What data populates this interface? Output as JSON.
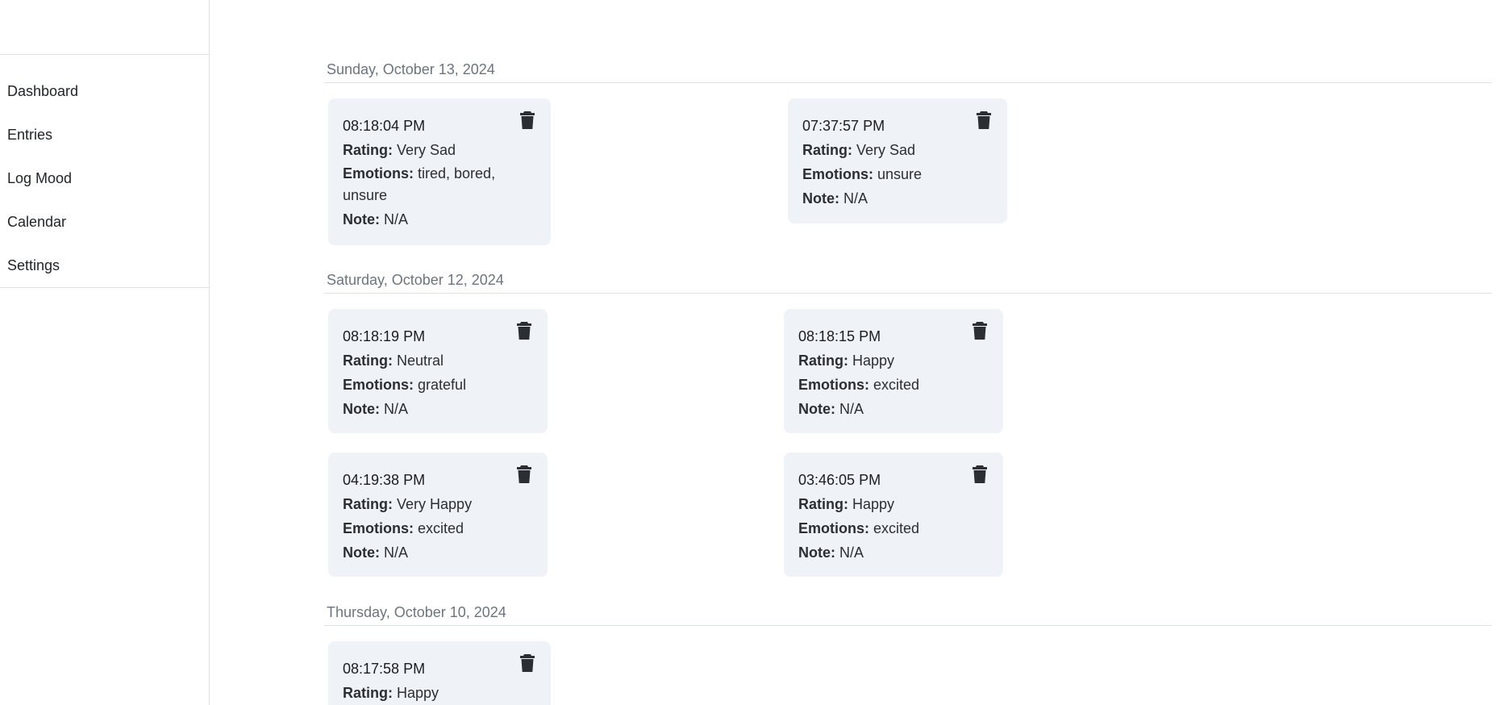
{
  "sidebar": {
    "items": [
      {
        "label": "Dashboard"
      },
      {
        "label": "Entries"
      },
      {
        "label": "Log Mood"
      },
      {
        "label": "Calendar"
      },
      {
        "label": "Settings"
      }
    ]
  },
  "labels": {
    "rating": "Rating:",
    "emotions": "Emotions:",
    "note": "Note:"
  },
  "days": [
    {
      "date": "Sunday, October 13, 2024",
      "entries": [
        {
          "time": "08:18:04 PM",
          "rating": "Very Sad",
          "emotions": "tired, bored, unsure",
          "note": "N/A"
        },
        {
          "time": "07:37:57 PM",
          "rating": "Very Sad",
          "emotions": "unsure",
          "note": "N/A"
        }
      ]
    },
    {
      "date": "Saturday, October 12, 2024",
      "entries": [
        {
          "time": "08:18:19 PM",
          "rating": "Neutral",
          "emotions": "grateful",
          "note": "N/A"
        },
        {
          "time": "08:18:15 PM",
          "rating": "Happy",
          "emotions": "excited",
          "note": "N/A"
        },
        {
          "time": "04:19:38 PM",
          "rating": "Very Happy",
          "emotions": "excited",
          "note": "N/A"
        },
        {
          "time": "03:46:05 PM",
          "rating": "Happy",
          "emotions": "excited",
          "note": "N/A"
        }
      ]
    },
    {
      "date": "Thursday, October 10, 2024",
      "entries": [
        {
          "time": "08:17:58 PM",
          "rating": "Happy",
          "emotions": "",
          "note": ""
        }
      ]
    }
  ],
  "icons": {
    "delete": "trash-icon"
  },
  "colors": {
    "card_background": "#eff2f7",
    "divider": "#dee2e6",
    "date_text": "#6c757d"
  }
}
